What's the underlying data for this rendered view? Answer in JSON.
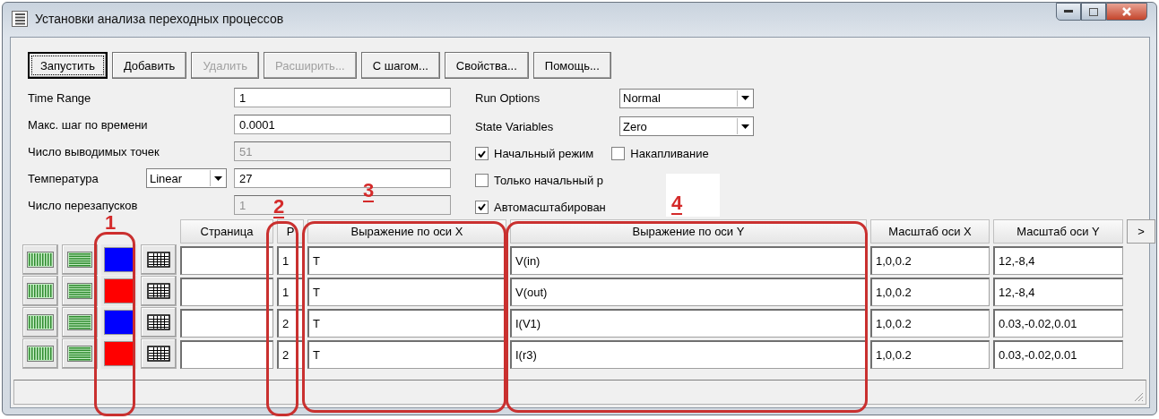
{
  "window": {
    "title": "Установки анализа переходных процессов"
  },
  "buttons": [
    {
      "label": "Запустить",
      "disabled": false,
      "focused": true
    },
    {
      "label": "Добавить",
      "disabled": false,
      "focused": false
    },
    {
      "label": "Удалить",
      "disabled": true,
      "focused": false
    },
    {
      "label": "Расширить...",
      "disabled": true,
      "focused": false
    },
    {
      "label": "С шагом...",
      "disabled": false,
      "focused": false
    },
    {
      "label": "Свойства...",
      "disabled": false,
      "focused": false
    },
    {
      "label": "Помощь...",
      "disabled": false,
      "focused": false
    }
  ],
  "fields": [
    {
      "label": "Time Range",
      "value": "1",
      "disabled": false
    },
    {
      "label": "Макс.  шаг по времени",
      "value": "0.0001",
      "disabled": false
    },
    {
      "label": "Число выводимых точек",
      "value": "51",
      "disabled": true
    },
    {
      "label": "Температура",
      "value": "27",
      "disabled": false,
      "mode": "Linear"
    },
    {
      "label": "Число перезапусков",
      "value": "1",
      "disabled": true
    }
  ],
  "options": [
    {
      "kind": "dropdown",
      "label": "Run Options",
      "value": "Normal"
    },
    {
      "kind": "dropdown",
      "label": "State Variables",
      "value": "Zero"
    }
  ],
  "checkboxes": [
    [
      {
        "label": "Начальный режим",
        "checked": true
      },
      {
        "label": "Накапливание",
        "checked": false
      }
    ],
    [
      {
        "label": "Только начальный р",
        "checked": false
      }
    ],
    [
      {
        "label": "Автомасштабирован",
        "checked": true
      }
    ]
  ],
  "table": {
    "columns": [
      "Страница",
      "P",
      "Выражение по оси X",
      "Выражение по оси Y",
      "Масштаб оси X",
      "Масштаб оси Y"
    ],
    "more": ">",
    "rows": [
      {
        "color": "#0000ff",
        "page": "",
        "p": "1",
        "x": "T",
        "y": "V(in)",
        "x_scale": "1,0,0.2",
        "y_scale": "12,-8,4"
      },
      {
        "color": "#ff0000",
        "page": "",
        "p": "1",
        "x": "T",
        "y": "V(out)",
        "x_scale": "1,0,0.2",
        "y_scale": "12,-8,4"
      },
      {
        "color": "#0000ff",
        "page": "",
        "p": "2",
        "x": "T",
        "y": "I(V1)",
        "x_scale": "1,0,0.2",
        "y_scale": "0.03,-0.02,0.01"
      },
      {
        "color": "#ff0000",
        "page": "",
        "p": "2",
        "x": "T",
        "y": "I(r3)",
        "x_scale": "1,0,0.2",
        "y_scale": "0.03,-0.02,0.01"
      }
    ]
  },
  "annotations": [
    "1",
    "2",
    "3",
    "4"
  ]
}
